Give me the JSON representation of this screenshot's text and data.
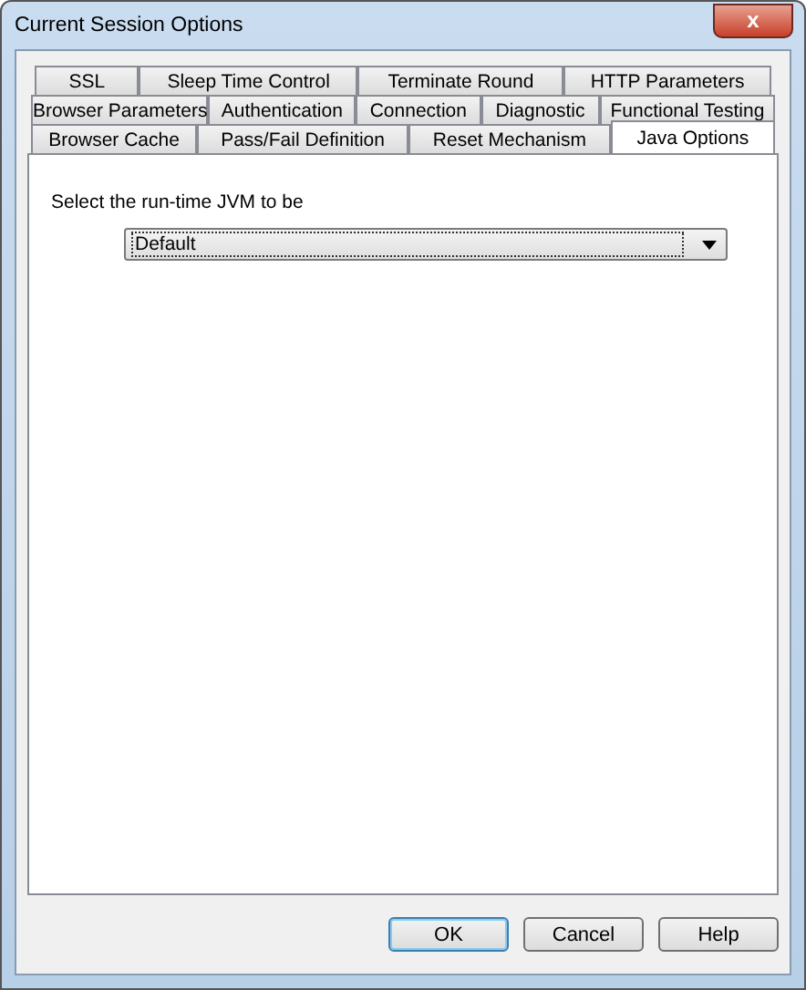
{
  "window": {
    "title": "Current Session Options",
    "close": "x"
  },
  "tab_rows": [
    {
      "tabs": [
        {
          "label": "SSL",
          "selected": false
        },
        {
          "label": "Sleep Time Control",
          "selected": false
        },
        {
          "label": "Terminate Round",
          "selected": false
        },
        {
          "label": "HTTP Parameters",
          "selected": false
        }
      ]
    },
    {
      "tabs": [
        {
          "label": "Browser Parameters",
          "selected": false
        },
        {
          "label": "Authentication",
          "selected": false
        },
        {
          "label": "Connection",
          "selected": false
        },
        {
          "label": "Diagnostic",
          "selected": false
        },
        {
          "label": "Functional Testing",
          "selected": false
        }
      ]
    },
    {
      "tabs": [
        {
          "label": "Browser Cache",
          "selected": false
        },
        {
          "label": "Pass/Fail Definition",
          "selected": false
        },
        {
          "label": "Reset Mechanism",
          "selected": false
        },
        {
          "label": "Java Options",
          "selected": true
        }
      ]
    }
  ],
  "panel": {
    "label": "Select the run-time JVM to be",
    "dropdown": {
      "value": "Default"
    }
  },
  "buttons": [
    {
      "label": "OK",
      "default": true
    },
    {
      "label": "Cancel",
      "default": false
    },
    {
      "label": "Help",
      "default": false
    }
  ]
}
